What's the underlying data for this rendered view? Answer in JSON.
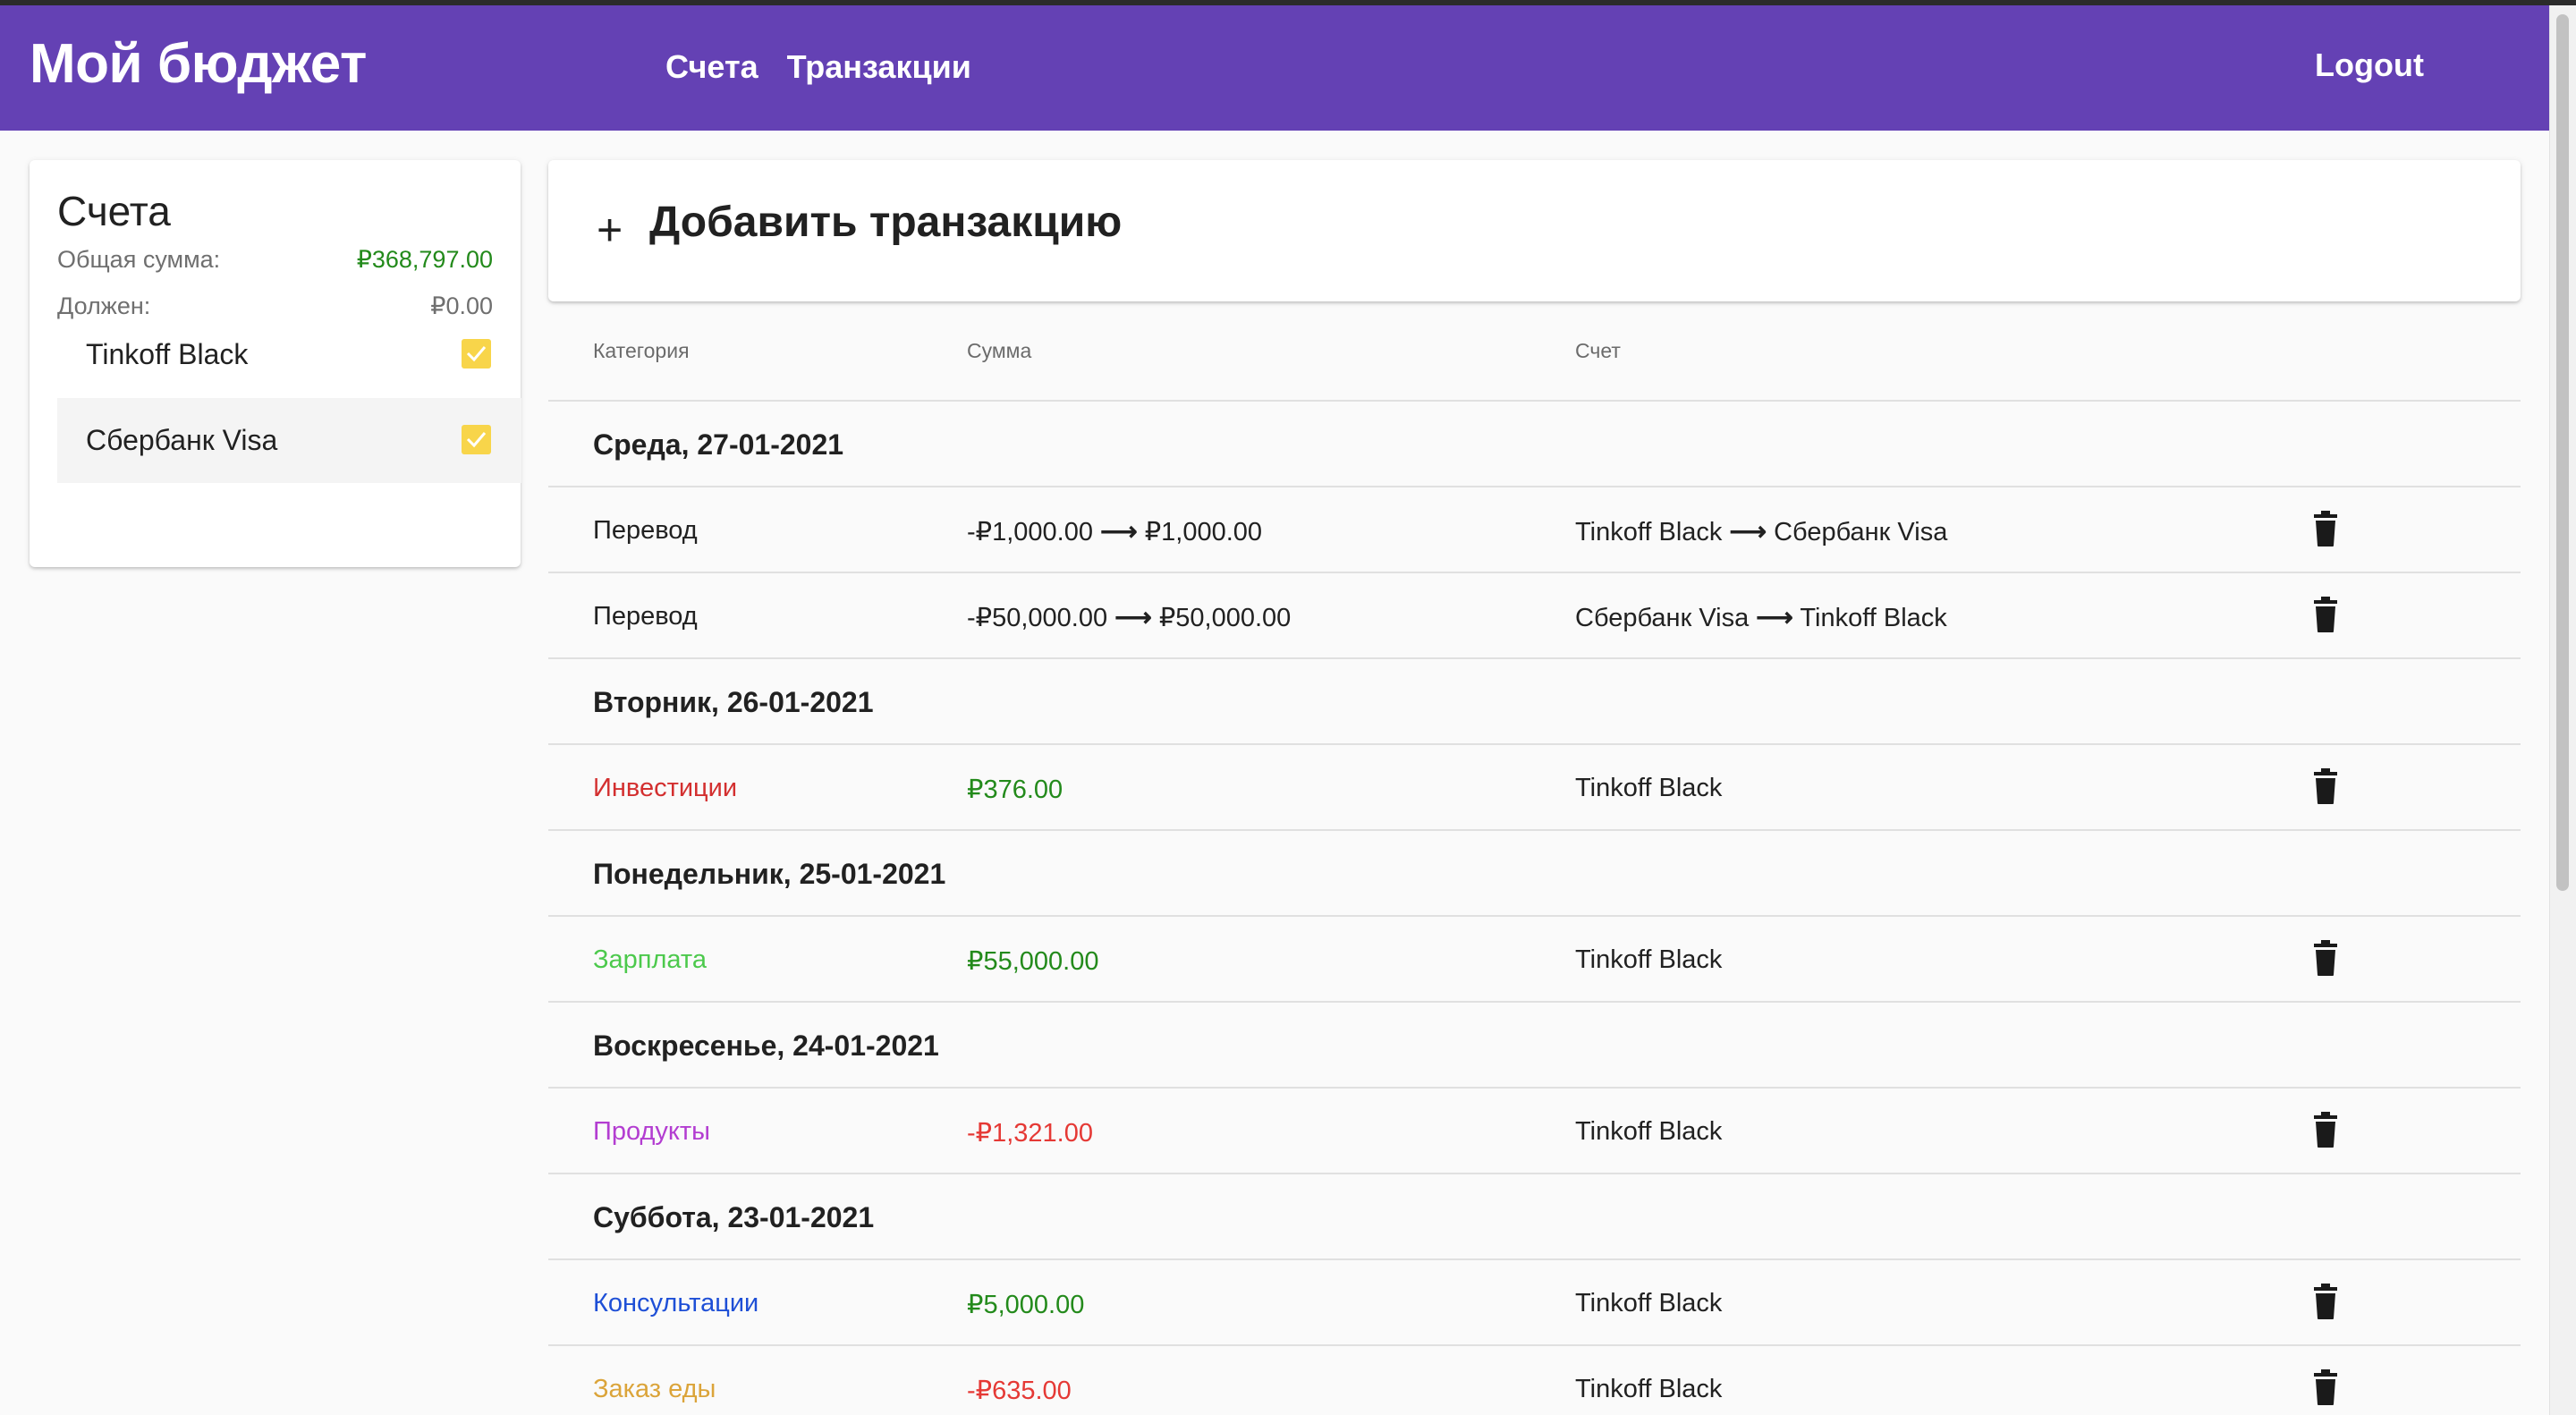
{
  "app": {
    "brand": "Мой бюджет",
    "nav": [
      "Счета",
      "Транзакции"
    ],
    "logout": "Logout"
  },
  "accounts_panel": {
    "title": "Счета",
    "total_label": "Общая сумма:",
    "total_value": "₽368,797.00",
    "debt_label": "Должен:",
    "debt_value": "₽0.00",
    "items": [
      {
        "name": "Tinkoff Black",
        "checked": true
      },
      {
        "name": "Сбербанк Visa",
        "checked": true
      }
    ]
  },
  "add_transaction": {
    "icon": "plus-icon",
    "label": "Добавить транзакцию"
  },
  "table": {
    "headers": [
      "Категория",
      "Сумма",
      "Счет"
    ],
    "groups": [
      {
        "date": "Среда, 27-01-2021",
        "rows": [
          {
            "category": "Перевод",
            "category_color": "#212121",
            "amount_from": "-₽1,000.00",
            "amount_to": "₽1,000.00",
            "account_from": "Tinkoff Black",
            "account_to": "Сбербанк Visa"
          },
          {
            "category": "Перевод",
            "category_color": "#212121",
            "amount_from": "-₽50,000.00",
            "amount_to": "₽50,000.00",
            "account_from": "Сбербанк Visa",
            "account_to": "Tinkoff Black"
          }
        ]
      },
      {
        "date": "Вторник, 26-01-2021",
        "rows": [
          {
            "category": "Инвестиции",
            "category_color": "#d32f2f",
            "amount": "₽376.00",
            "amount_color": "#238a1b",
            "account": "Tinkoff Black"
          }
        ]
      },
      {
        "date": "Понедельник, 25-01-2021",
        "rows": [
          {
            "category": "Зарплата",
            "category_color": "#4cc94c",
            "amount": "₽55,000.00",
            "amount_color": "#238a1b",
            "account": "Tinkoff Black"
          }
        ]
      },
      {
        "date": "Воскресенье, 24-01-2021",
        "rows": [
          {
            "category": "Продукты",
            "category_color": "#b33dd1",
            "amount": "-₽1,321.00",
            "amount_color": "#e53935",
            "account": "Tinkoff Black"
          }
        ]
      },
      {
        "date": "Суббота, 23-01-2021",
        "rows": [
          {
            "category": "Консультации",
            "category_color": "#1e4fd6",
            "amount": "₽5,000.00",
            "amount_color": "#238a1b",
            "account": "Tinkoff Black"
          },
          {
            "category": "Заказ еды",
            "category_color": "#dba43a",
            "amount": "-₽635.00",
            "amount_color": "#e53935",
            "account": "Tinkoff Black"
          }
        ]
      }
    ],
    "arrow": "⟶",
    "row_icon": "trash-icon"
  },
  "colors": {
    "appbar": "#6441b4",
    "checkbox": "#f8d54a",
    "positive": "#238a1b",
    "negative": "#e53935"
  }
}
